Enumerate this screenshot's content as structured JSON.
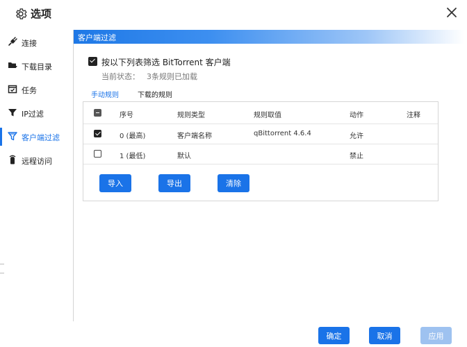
{
  "window": {
    "title": "选项"
  },
  "sidebar": {
    "items": [
      {
        "label": "连接",
        "icon": "plug-icon"
      },
      {
        "label": "下载目录",
        "icon": "folder-icon"
      },
      {
        "label": "任务",
        "icon": "calendar-check-icon"
      },
      {
        "label": "IP过滤",
        "icon": "filter-icon"
      },
      {
        "label": "客户端过滤",
        "icon": "filter-outline-icon",
        "active": true
      },
      {
        "label": "远程访问",
        "icon": "remote-icon"
      }
    ]
  },
  "section": {
    "title": "客户端过滤",
    "filter_checkbox_label": "按以下列表筛选 BitTorrent 客户端",
    "filter_checked": true,
    "status_label": "当前状态：",
    "status_value": "3条规则已加载"
  },
  "tabs": [
    {
      "label": "手动规则",
      "active": true
    },
    {
      "label": "下载的规则",
      "active": false
    }
  ],
  "table": {
    "columns": [
      "序号",
      "规则类型",
      "规则取值",
      "动作",
      "注释"
    ],
    "header_checkbox": "indeterminate",
    "rows": [
      {
        "checked": true,
        "index": "0 (最高)",
        "type": "客户端名称",
        "value": "qBittorrent 4.6.4",
        "action": "允许",
        "note": ""
      },
      {
        "checked": false,
        "index": "1 (最低)",
        "type": "默认",
        "value": "",
        "action": "禁止",
        "note": ""
      }
    ]
  },
  "actions": {
    "import": "导入",
    "export": "导出",
    "clear": "清除"
  },
  "footer": {
    "ok": "确定",
    "cancel": "取消",
    "apply": "应用"
  },
  "colors": {
    "accent": "#1a73e8",
    "disabled": "#9ec2f0"
  }
}
